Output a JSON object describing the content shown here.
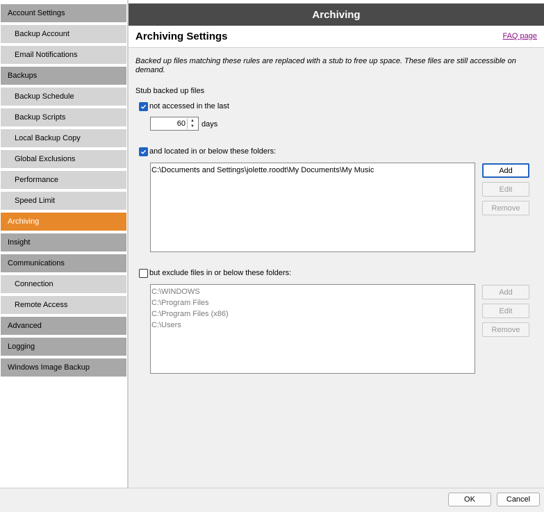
{
  "sidebar": {
    "items": [
      {
        "label": "Account Settings",
        "kind": "group"
      },
      {
        "label": "Backup Account",
        "kind": "child"
      },
      {
        "label": "Email Notifications",
        "kind": "child"
      },
      {
        "label": "Backups",
        "kind": "group"
      },
      {
        "label": "Backup Schedule",
        "kind": "child"
      },
      {
        "label": "Backup Scripts",
        "kind": "child"
      },
      {
        "label": "Local Backup Copy",
        "kind": "child"
      },
      {
        "label": "Global Exclusions",
        "kind": "child"
      },
      {
        "label": "Performance",
        "kind": "child"
      },
      {
        "label": "Speed Limit",
        "kind": "child"
      },
      {
        "label": "Archiving",
        "kind": "active"
      },
      {
        "label": "Insight",
        "kind": "group"
      },
      {
        "label": "Communications",
        "kind": "group"
      },
      {
        "label": "Connection",
        "kind": "child"
      },
      {
        "label": "Remote Access",
        "kind": "child"
      },
      {
        "label": "Advanced",
        "kind": "group"
      },
      {
        "label": "Logging",
        "kind": "group"
      },
      {
        "label": "Windows Image Backup",
        "kind": "group"
      }
    ]
  },
  "header": {
    "title": "Archiving"
  },
  "section": {
    "title": "Archiving Settings",
    "faq_label": "FAQ page"
  },
  "description": "Backed up files matching these rules are replaced with a stub to free up space. These files are still accessible on demand.",
  "stub": {
    "heading": "Stub backed up files",
    "not_accessed": {
      "label": "not accessed in the last",
      "checked": true
    },
    "days_value": "60",
    "days_unit": "days",
    "located": {
      "label": "and located in or below these folders:",
      "checked": true
    },
    "include_folders": [
      "C:\\Documents and Settings\\jolette.roodt\\My Documents\\My Music"
    ],
    "include_buttons": {
      "add": "Add",
      "edit": "Edit",
      "remove": "Remove"
    },
    "exclude": {
      "label": "but exclude files in or below these folders:",
      "checked": false
    },
    "exclude_folders": [
      "C:\\WINDOWS",
      "C:\\Program Files",
      "C:\\Program Files (x86)",
      "C:\\Users"
    ],
    "exclude_buttons": {
      "add": "Add",
      "edit": "Edit",
      "remove": "Remove"
    }
  },
  "footer": {
    "ok": "OK",
    "cancel": "Cancel"
  },
  "colors": {
    "accent": "#e7892b",
    "header": "#4a4a4a",
    "checkbox": "#1f62c1",
    "link": "#8a0f8a"
  }
}
